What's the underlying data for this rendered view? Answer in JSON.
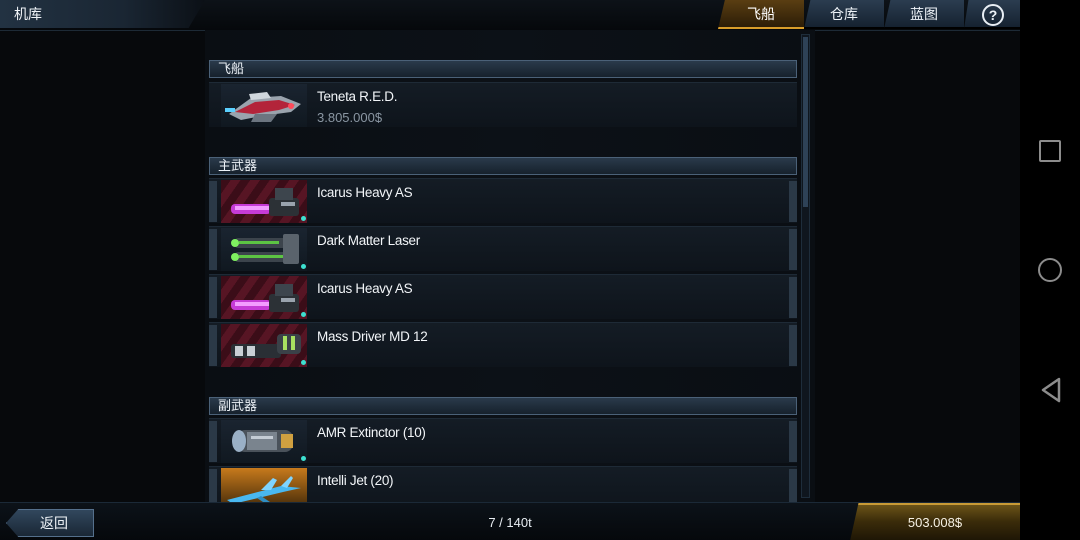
{
  "title": "机库",
  "tabs": [
    {
      "label": "飞船",
      "active": true
    },
    {
      "label": "仓库",
      "active": false
    },
    {
      "label": "蓝图",
      "active": false
    }
  ],
  "help_icon": "question-mark-icon",
  "sections": {
    "ships": {
      "header": "飞船",
      "items": [
        {
          "name": "Teneta R.E.D.",
          "price": "3.805.000$",
          "icon": "spaceship-icon"
        }
      ]
    },
    "primary": {
      "header": "主武器",
      "items": [
        {
          "name": "Icarus Heavy AS",
          "icon": "purple-laser-gun-icon"
        },
        {
          "name": "Dark Matter Laser",
          "icon": "green-laser-cannon-icon"
        },
        {
          "name": "Icarus Heavy AS",
          "icon": "purple-laser-gun-icon"
        },
        {
          "name": "Mass Driver MD 12",
          "icon": "mass-driver-cannon-icon"
        }
      ]
    },
    "secondary": {
      "header": "副武器",
      "items": [
        {
          "name": "AMR Extinctor (10)",
          "icon": "missile-pod-icon"
        },
        {
          "name": "Intelli Jet (20)",
          "icon": "blue-rocket-icon"
        }
      ]
    }
  },
  "footer": {
    "back_label": "返回",
    "capacity": "7 / 140t",
    "credits": "503.008$"
  },
  "colors": {
    "active_tab_accent": "#d99d2a",
    "status_dot": "#3de0d0",
    "credits_gold": "#c99a36"
  }
}
